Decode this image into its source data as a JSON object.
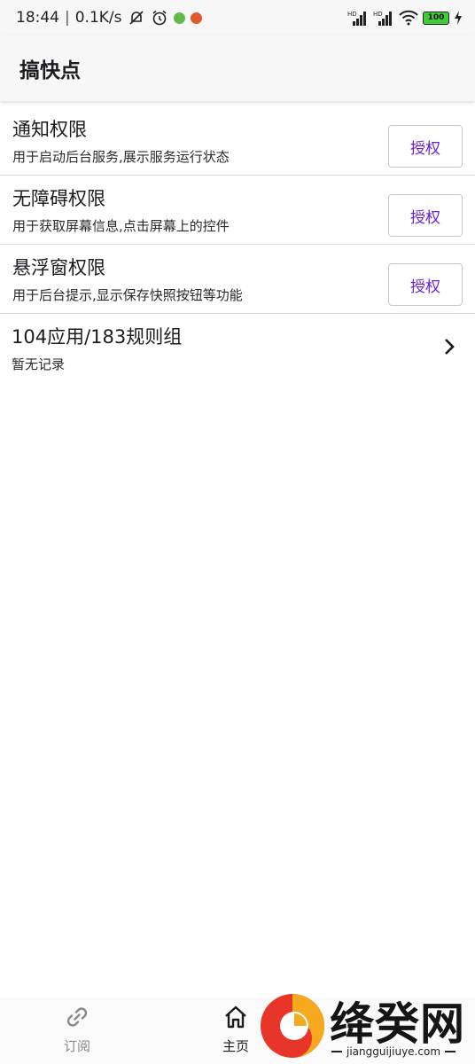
{
  "status_bar": {
    "time": "18:44",
    "network_speed": "0.1K/s",
    "battery_level": "100",
    "signal_label_1": "HD",
    "signal_label_2": "HD"
  },
  "app_bar": {
    "title": "搞快点"
  },
  "permissions": [
    {
      "title": "通知权限",
      "description": "用于启动后台服务,展示服务运行状态",
      "button_label": "授权"
    },
    {
      "title": "无障碍权限",
      "description": "用于获取屏幕信息,点击屏幕上的控件",
      "button_label": "授权"
    },
    {
      "title": "悬浮窗权限",
      "description": "用于后台提示,显示保存快照按钮等功能",
      "button_label": "授权"
    }
  ],
  "rules_summary": {
    "title": "104应用/183规则组",
    "subtitle": "暂无记录"
  },
  "bottom_nav": [
    {
      "label": "订阅",
      "icon": "link-icon"
    },
    {
      "label": "主页",
      "icon": "home-icon"
    }
  ],
  "watermark": {
    "text": "绛癸网",
    "url": "jiangguijiuye.com"
  },
  "colors": {
    "accent": "#6a1fd6",
    "divider": "#d9d9d9",
    "bar_background": "#f7f7f7"
  }
}
